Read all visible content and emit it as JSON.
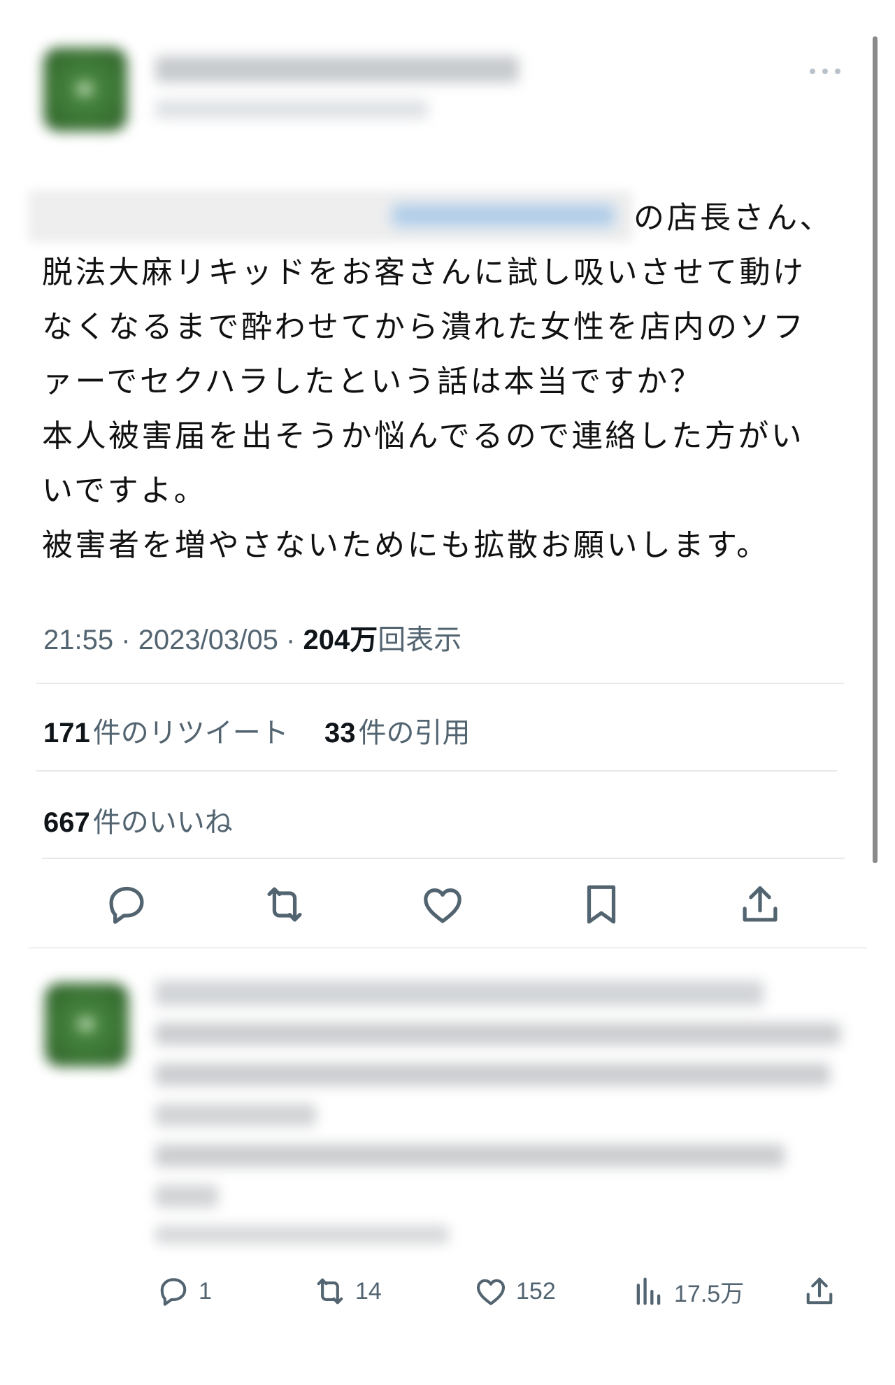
{
  "tweet": {
    "author_name": "",
    "text_lines": [
      "の店長さん、",
      "脱法大麻リキッドをお客さんに試し吸いさせて動け",
      "なくなるまで酔わせてから潰れた女性を店内のソフ",
      "ァーでセクハラしたという話は本当ですか？",
      "本人被害届を出そうか悩んでるので連絡した方がい",
      "いですよ。",
      "被害者を増やさないためにも拡散お願いします。"
    ],
    "time": "21:55",
    "date": "2023/03/05",
    "views_number": "204",
    "views_unit": "万",
    "views_label": "回表示",
    "separator": "·",
    "retweets_count": "171",
    "retweets_label": "件のリツイート",
    "quotes_count": "33",
    "quotes_label": "件の引用",
    "likes_count": "667",
    "likes_label": "件のいいね"
  },
  "actions": [
    {
      "icon": "reply-icon"
    },
    {
      "icon": "retweet-icon"
    },
    {
      "icon": "like-icon"
    },
    {
      "icon": "bookmark-icon"
    },
    {
      "icon": "share-icon"
    }
  ],
  "reply": {
    "replies": "1",
    "retweets": "14",
    "likes": "152",
    "views": "17.5万"
  },
  "colors": {
    "text": "#0f1419",
    "secondary": "#536471",
    "divider": "#e6e9ec",
    "icon": "#536471"
  }
}
